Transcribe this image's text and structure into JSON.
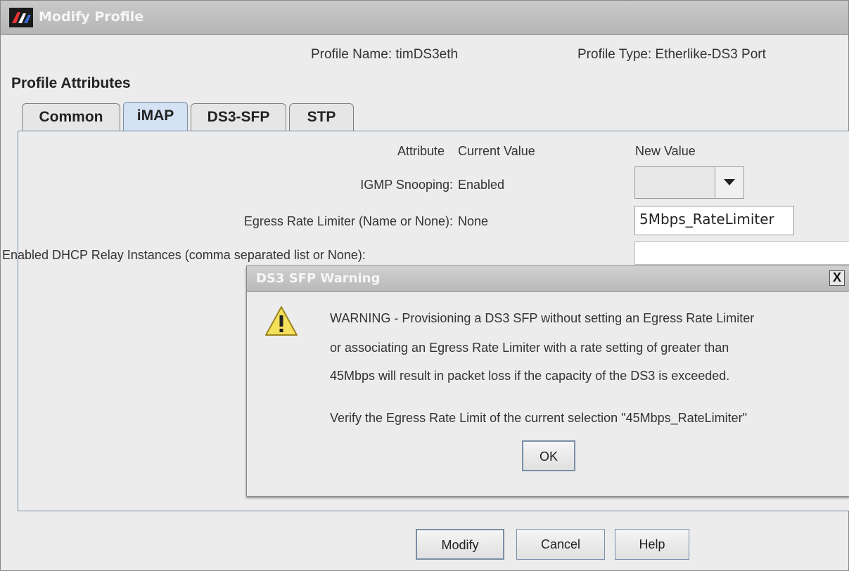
{
  "window": {
    "title": "Modify Profile"
  },
  "header": {
    "profile_name": "Profile Name:  timDS3eth",
    "profile_type": "Profile Type:  Etherlike-DS3 Port",
    "section_heading": "Profile Attributes"
  },
  "tabs": [
    {
      "label": "Common",
      "active": false
    },
    {
      "label": "iMAP",
      "active": true
    },
    {
      "label": "DS3-SFP",
      "active": false
    },
    {
      "label": "STP",
      "active": false
    }
  ],
  "attributes": {
    "col_attribute": "Attribute",
    "col_current": "Current Value",
    "col_new": "New Value",
    "rows": [
      {
        "label": "IGMP Snooping:",
        "current": "Enabled",
        "new_value": ""
      },
      {
        "label": "Egress Rate Limiter (Name or None):",
        "current": "None",
        "new_value": "5Mbps_RateLimiter"
      },
      {
        "label": "Enabled DHCP Relay Instances (comma separated list or None):",
        "current": "",
        "new_value": ""
      }
    ]
  },
  "dialog": {
    "title": "DS3 SFP Warning",
    "close_label": "X",
    "icon": "warning-triangle-icon",
    "lines": [
      "WARNING - Provisioning a DS3 SFP without setting an Egress Rate Limiter",
      "or associating an Egress Rate Limiter with a rate setting of greater than",
      "45Mbps will result in packet loss if the capacity of the DS3 is exceeded.",
      "Verify the Egress Rate Limit of the current selection \"45Mbps_RateLimiter\""
    ],
    "ok_label": "OK"
  },
  "footer": {
    "modify_label": "Modify",
    "cancel_label": "Cancel",
    "help_label": "Help"
  }
}
